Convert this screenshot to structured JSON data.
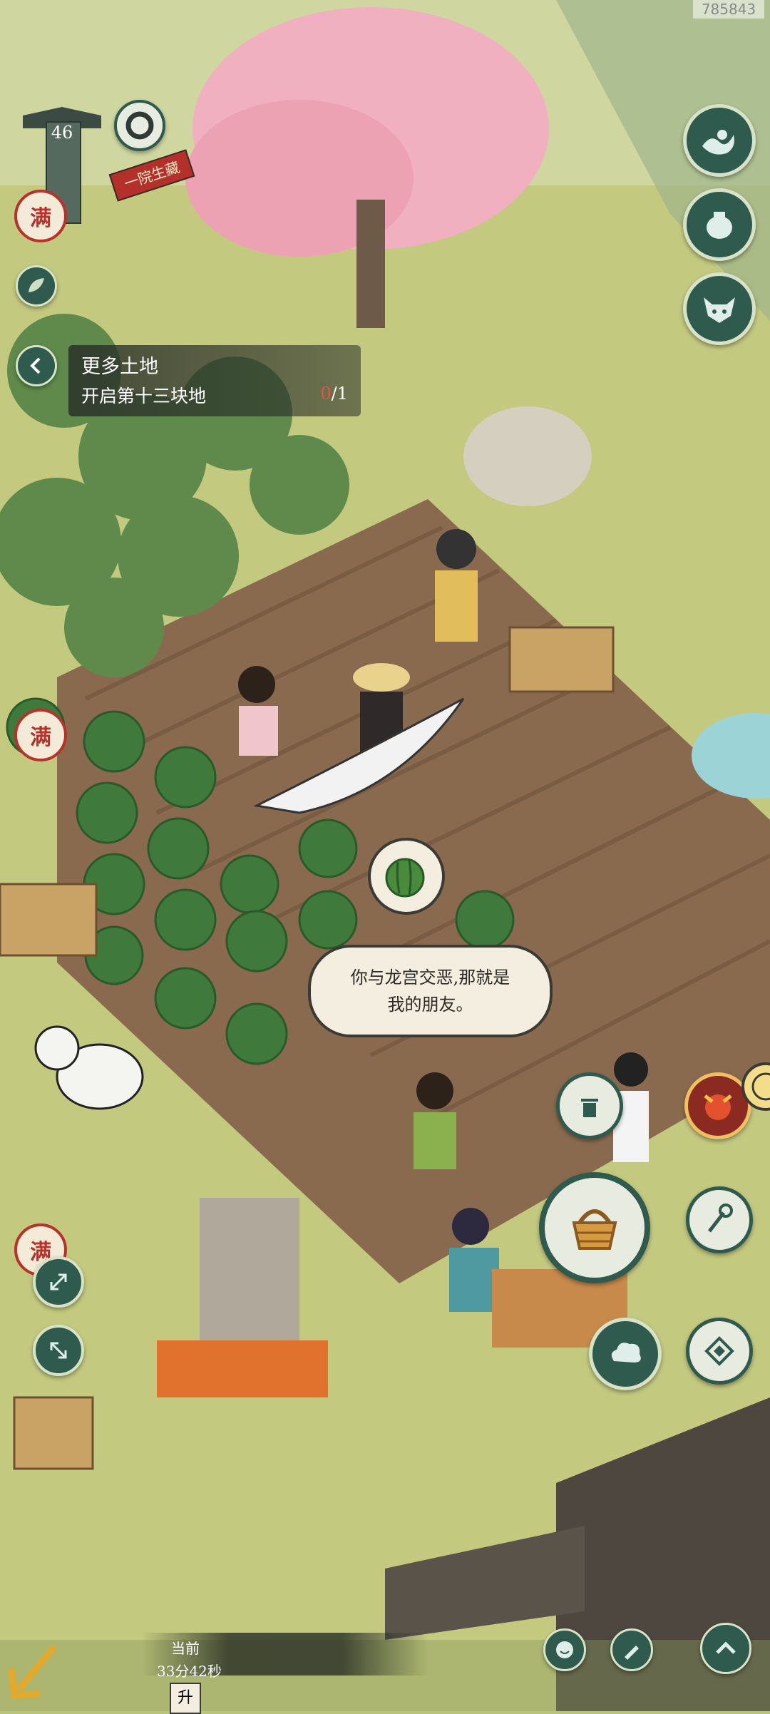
{
  "watermark": "785843",
  "player": {
    "level": "46",
    "banner_text": "一院生藏"
  },
  "quest": {
    "title": "更多土地",
    "desc": "开启第十三块地",
    "progress_current": "0",
    "progress_total": "/1"
  },
  "speech": {
    "line1": "你与龙宫交恶,那就是",
    "line2": "我的朋友。"
  },
  "badges": {
    "full_label": "满"
  },
  "timer": {
    "label": "当前",
    "value": "33分42秒",
    "bottom_char": "升"
  },
  "colors": {
    "accent": "#2f5b4e",
    "badge_red": "#b8322b",
    "speech_bg": "#f3eedf"
  },
  "icons": {
    "right_top": [
      "wave-icon",
      "pot-icon",
      "ox-mask-icon"
    ],
    "right_mid": [
      "trash-icon",
      "demon-face-icon",
      "wheel-icon",
      "basket-icon",
      "brush-icon",
      "cloud-icon",
      "diamond-icon"
    ],
    "left": [
      "leaf-icon",
      "back-icon",
      "expand-icon",
      "collapse-icon"
    ],
    "bottom": [
      "smile-icon",
      "pen-icon",
      "up-arrow-icon"
    ]
  }
}
